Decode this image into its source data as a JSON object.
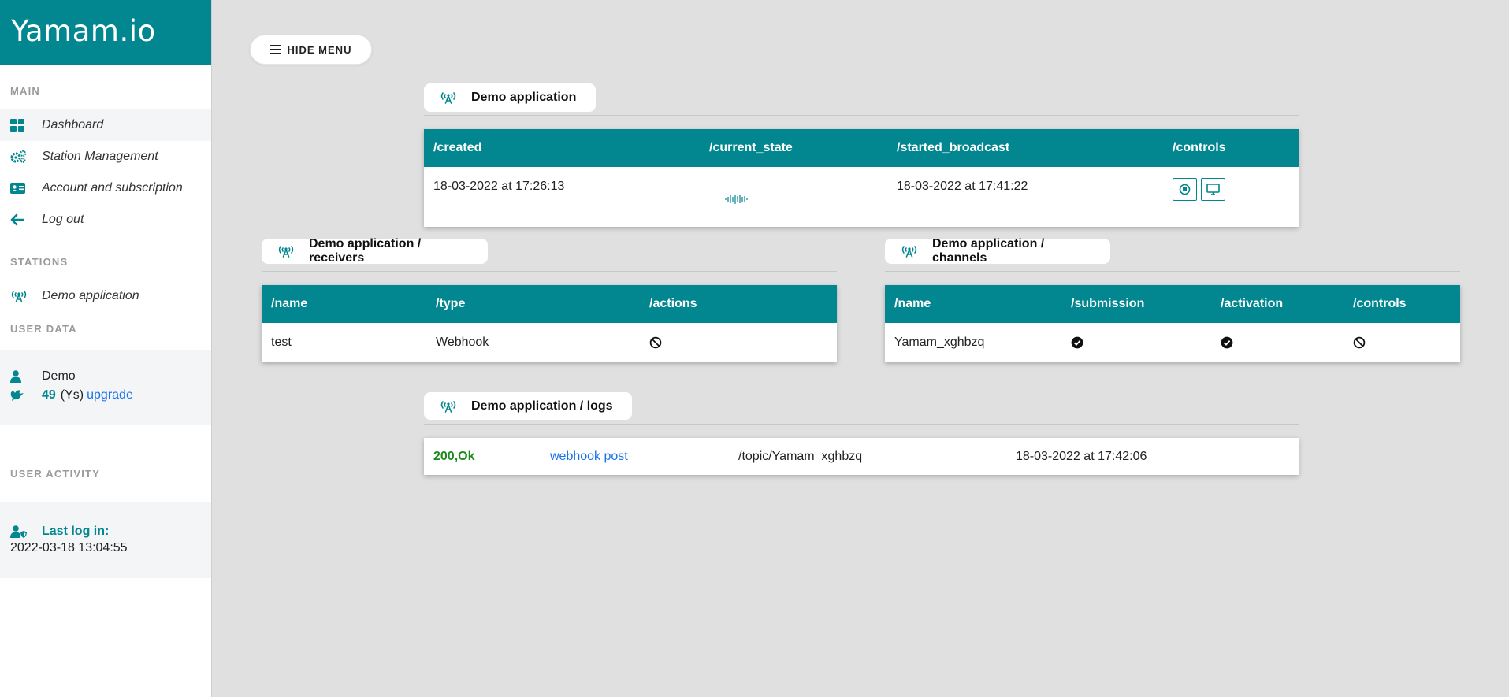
{
  "brand": "Yamam.io",
  "sidebar": {
    "main_title": "MAIN",
    "items": [
      {
        "label": "Dashboard",
        "icon": "dashboard-icon"
      },
      {
        "label": "Station Management",
        "icon": "gears-icon"
      },
      {
        "label": "Account and subscription",
        "icon": "id-card-icon"
      },
      {
        "label": "Log out",
        "icon": "arrow-left-icon"
      }
    ],
    "stations_title": "STATIONS",
    "stations": [
      {
        "label": "Demo application",
        "icon": "broadcast-tower-icon"
      }
    ],
    "user_data_title": "USER DATA",
    "user": {
      "name": "Demo",
      "credits": "49",
      "credits_unit": "(Ys)",
      "upgrade": "upgrade"
    },
    "activity_title": "USER ACTIVITY",
    "last_login_label": "Last log in:",
    "last_login_value": "2022-03-18 13:04:55"
  },
  "hide_menu_label": "HIDE MENU",
  "app": {
    "title": "Demo application",
    "headers": [
      "/created",
      "/current_state",
      "/started_broadcast",
      "/controls"
    ],
    "created": "18-03-2022 at 17:26:13",
    "started_broadcast": "18-03-2022 at 17:41:22"
  },
  "receivers": {
    "title": "Demo application / receivers",
    "headers": [
      "/name",
      "/type",
      "/actions"
    ],
    "rows": [
      {
        "name": "test",
        "type": "Webhook"
      }
    ]
  },
  "channels": {
    "title": "Demo application / channels",
    "headers": [
      "/name",
      "/submission",
      "/activation",
      "/controls"
    ],
    "rows": [
      {
        "name": "Yamam_xghbzq"
      }
    ]
  },
  "logs": {
    "title": "Demo application / logs",
    "rows": [
      {
        "status": "200,Ok",
        "event": "webhook post",
        "topic": "/topic/Yamam_xghbzq",
        "time": "18-03-2022 at 17:42:06"
      }
    ]
  },
  "colors": {
    "accent": "#02868f",
    "link": "#1a73e8",
    "status_ok": "#1a8a1a"
  }
}
